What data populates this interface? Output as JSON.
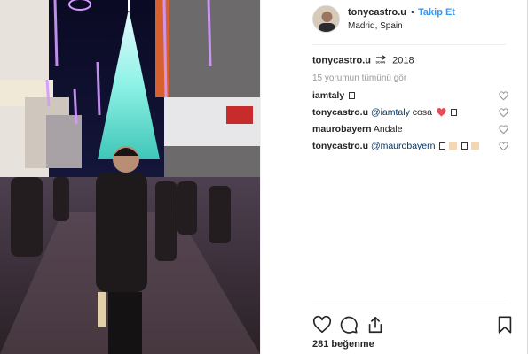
{
  "post": {
    "author": "tonycastro.u",
    "separator": "•",
    "follow_label": "Takip Et",
    "location": "Madrid, Spain"
  },
  "caption": {
    "user": "tonycastro.u",
    "icon": "soon-arrow-emoji",
    "text": "2018"
  },
  "view_all_comments": "15 yorumun tümünü gör",
  "comments": [
    {
      "user": "iamtaly",
      "mention": "",
      "text": "",
      "emoji": [
        "box-glyph"
      ]
    },
    {
      "user": "tonycastro.u",
      "mention": "@iamtaly",
      "text": "cosa",
      "emoji": [
        "red-heart",
        "box-glyph"
      ]
    },
    {
      "user": "maurobayern",
      "mention": "",
      "text": "Andale",
      "emoji": []
    },
    {
      "user": "tonycastro.u",
      "mention": "@maurobayern",
      "text": "",
      "emoji": [
        "box-glyph",
        "skin-tone",
        "box-glyph",
        "skin-tone"
      ]
    }
  ],
  "actions": {
    "like": "heart-icon",
    "comment": "comment-icon",
    "share": "share-icon",
    "save": "bookmark-icon"
  },
  "likes_text": "281 beğenme",
  "colors": {
    "link_blue": "#3897f0",
    "mention_blue": "#003569",
    "muted_gray": "#999999",
    "heart_red": "#ed4956"
  }
}
